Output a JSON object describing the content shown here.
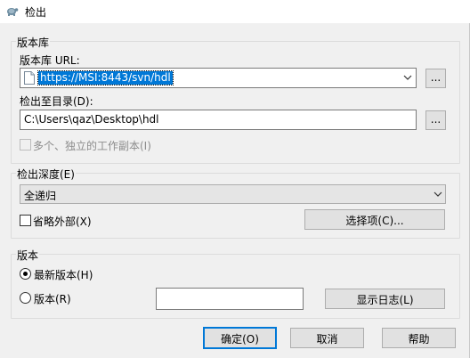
{
  "window": {
    "title": "检出"
  },
  "repo_group": {
    "title": "版本库",
    "url_label": "版本库 URL:",
    "url_value": "https://MSI:8443/svn/hdl",
    "browse_label": "...",
    "checkout_dir_label": "检出至目录(D):",
    "checkout_dir_value": "C:\\Users\\qaz\\Desktop\\hdl",
    "browse_dir_label": "...",
    "multi_copy_label": "多个、独立的工作副本(I)"
  },
  "depth_group": {
    "title": "检出深度(E)",
    "depth_value": "全递归",
    "omit_externals_label": "省略外部(X)",
    "choose_items_label": "选择项(C)..."
  },
  "revision_group": {
    "title": "版本",
    "head_label": "最新版本(H)",
    "revision_label": "版本(R)",
    "revision_value": "",
    "show_log_label": "显示日志(L)"
  },
  "footer": {
    "ok_label": "确定(O)",
    "cancel_label": "取消",
    "help_label": "帮助"
  },
  "colors": {
    "accent": "#0078d7",
    "background": "#f0f0f0",
    "button": "#e1e1e1"
  }
}
